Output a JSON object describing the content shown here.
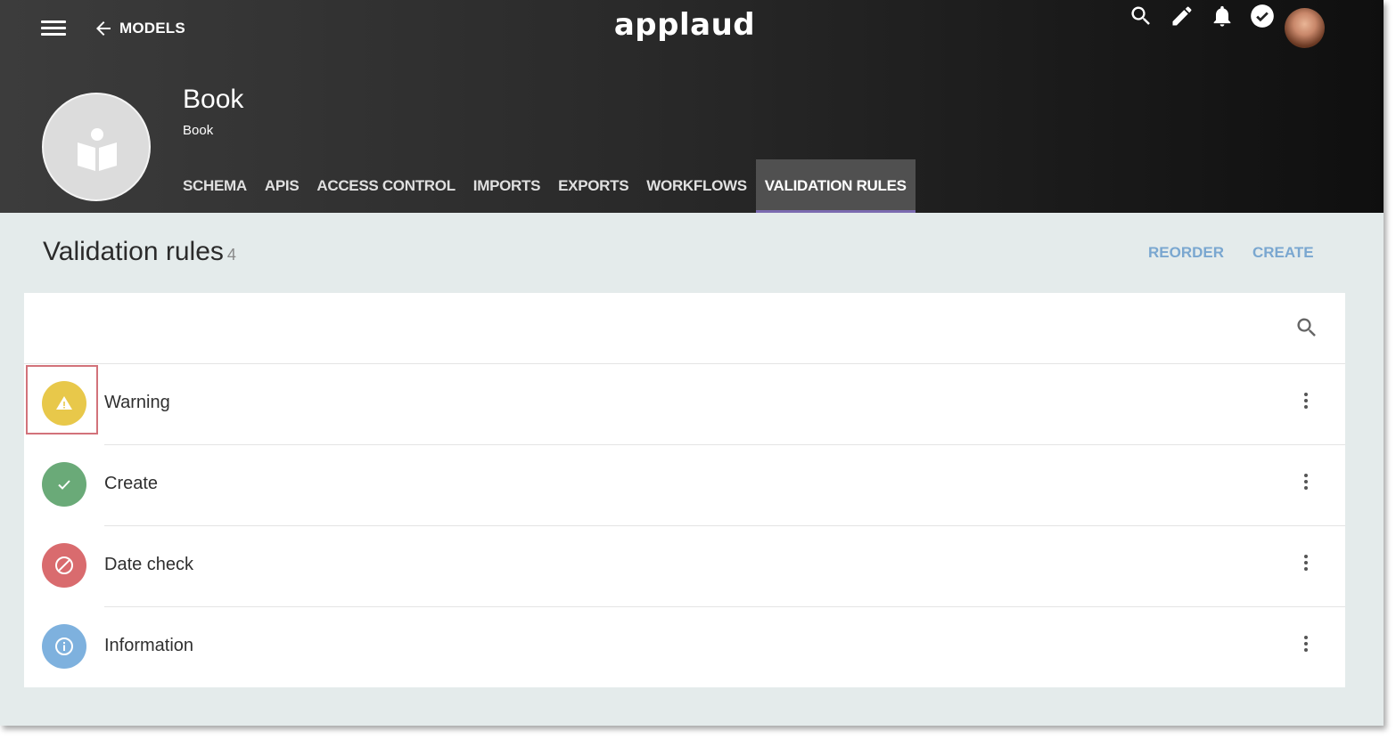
{
  "header": {
    "back_label": "MODELS",
    "logo": "applaud",
    "icons": [
      "menu-icon",
      "arrow-back-icon",
      "search-icon",
      "pencil-icon",
      "bell-icon",
      "check-circle-icon",
      "avatar"
    ]
  },
  "model": {
    "title": "Book",
    "subtitle": "Book",
    "icon": "book-reader-icon"
  },
  "tabs": [
    {
      "label": "SCHEMA"
    },
    {
      "label": "APIS"
    },
    {
      "label": "ACCESS CONTROL"
    },
    {
      "label": "IMPORTS"
    },
    {
      "label": "EXPORTS"
    },
    {
      "label": "WORKFLOWS"
    },
    {
      "label": "VALIDATION RULES",
      "active": true
    }
  ],
  "page": {
    "heading": "Validation rules",
    "count": "4",
    "reorder_label": "REORDER",
    "create_label": "CREATE"
  },
  "rules": [
    {
      "label": "Warning",
      "icon": "warning-icon",
      "color": "#e8c84a"
    },
    {
      "label": "Create",
      "icon": "check-icon",
      "color": "#6aaa78"
    },
    {
      "label": "Date check",
      "icon": "block-icon",
      "color": "#d96b6e"
    },
    {
      "label": "Information",
      "icon": "info-icon",
      "color": "#7eb1de"
    }
  ],
  "colors": {
    "accent_link": "#7aa7d0",
    "active_tab_underline": "#7b6bb0",
    "highlight_box": "#d2727a"
  }
}
